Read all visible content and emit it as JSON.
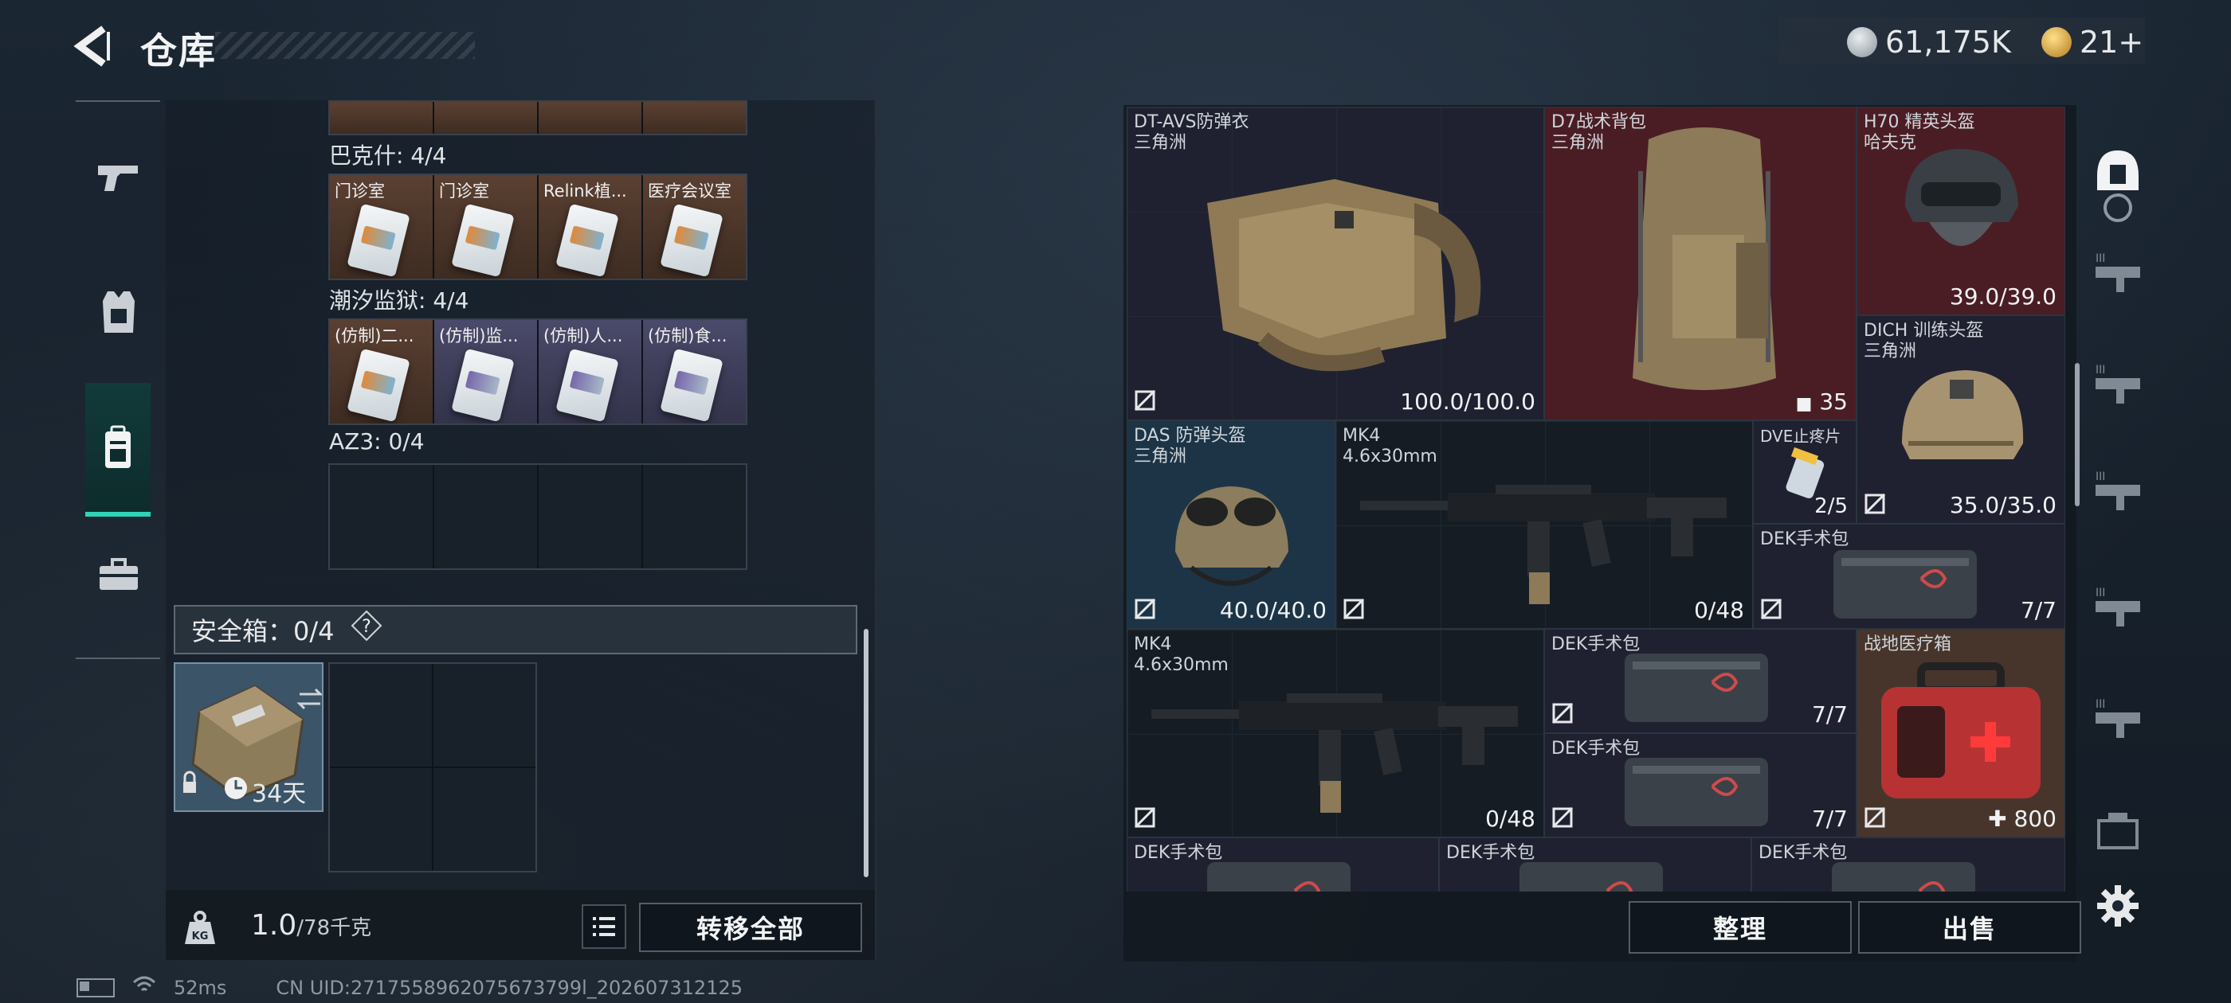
{
  "header": {
    "title": "仓库",
    "currency1": "61,175K",
    "currency2": "21+"
  },
  "left_nav": {
    "items": [
      "weapon-icon",
      "armor-icon",
      "backpack-icon",
      "case-icon"
    ],
    "active": "backpack-icon"
  },
  "sections": [
    {
      "label": "巴克什: 4/4",
      "color": "orange",
      "cards": [
        "门诊室",
        "门诊室",
        "Relink植...",
        "医疗会议室"
      ]
    },
    {
      "label": "潮汐监狱: 4/4",
      "color": "mixed",
      "cards": [
        "(仿制)二...",
        "(仿制)监...",
        "(仿制)人...",
        "(仿制)食..."
      ]
    },
    {
      "label": "AZ3: 0/4",
      "color": "empty",
      "cards": [
        "",
        "",
        "",
        ""
      ]
    }
  ],
  "safe_box": {
    "label": "安全箱：0/4",
    "help": "?",
    "days": "34天"
  },
  "weight": {
    "current": "1.0",
    "max": "/78千克",
    "transfer_label": "转移全部"
  },
  "status": {
    "ping": "52ms",
    "uid": "CN UID:2717558962075673799l_202607312125"
  },
  "inventory": {
    "items": [
      {
        "name": "DT-AVS防弹衣",
        "sub": "三角洲",
        "stat": "100.0/100.0",
        "color": "navy"
      },
      {
        "name": "D7战术背包",
        "sub": "三角洲",
        "stat": "35",
        "color": "red"
      },
      {
        "name": "H70 精英头盔",
        "sub": "哈夫克",
        "stat": "39.0/39.0",
        "color": "red"
      },
      {
        "name": "DICH 训练头盔",
        "sub": "三角洲",
        "stat": "35.0/35.0",
        "color": "navy"
      },
      {
        "name": "DAS 防弹头盔",
        "sub": "三角洲",
        "stat": "40.0/40.0",
        "color": "teal"
      },
      {
        "name": "MK4",
        "sub": "4.6x30mm",
        "stat": "0/48",
        "color": "dark"
      },
      {
        "name": "DVE止疼片",
        "sub": "",
        "stat": "2/5",
        "color": "navy"
      },
      {
        "name": "DEK手术包",
        "sub": "",
        "stat": "7/7",
        "color": "navy"
      },
      {
        "name": "MK4",
        "sub": "4.6x30mm",
        "stat": "0/48",
        "color": "dark"
      },
      {
        "name": "DEK手术包",
        "sub": "",
        "stat": "7/7",
        "color": "navy"
      },
      {
        "name": "DEK手术包",
        "sub": "",
        "stat": "7/7",
        "color": "navy"
      },
      {
        "name": "战地医疗箱",
        "sub": "",
        "stat": "800",
        "color": "brown"
      },
      {
        "name": "DEK手术包",
        "sub": "",
        "stat": "",
        "color": "navy"
      },
      {
        "name": "DEK手术包",
        "sub": "",
        "stat": "",
        "color": "navy"
      },
      {
        "name": "DEK手术包",
        "sub": "",
        "stat": "",
        "color": "navy"
      }
    ],
    "sort_label": "整理",
    "sell_label": "出售"
  }
}
